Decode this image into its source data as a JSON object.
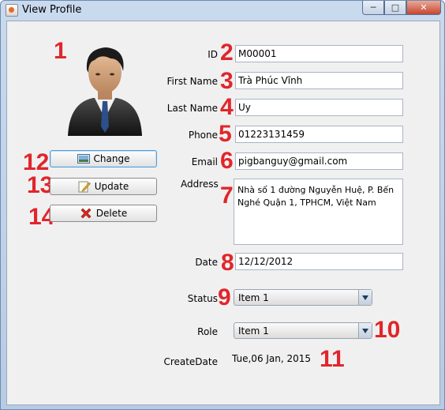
{
  "window": {
    "title": "View Profile",
    "controls": [
      "minimize",
      "restore",
      "close"
    ]
  },
  "markers": [
    "1",
    "2",
    "3",
    "4",
    "5",
    "6",
    "7",
    "8",
    "9",
    "10",
    "11",
    "12",
    "13",
    "14"
  ],
  "buttons": {
    "change": "Change",
    "update": "Update",
    "delete": "Delete"
  },
  "labels": {
    "id": "ID",
    "first_name": "First Name",
    "last_name": "Last Name",
    "phone": "Phone",
    "email": "Email",
    "address": "Address",
    "date": "Date",
    "status": "Status",
    "role": "Role",
    "create_date": "CreateDate"
  },
  "values": {
    "id": "M00001",
    "first_name": "Trà Phúc Vĩnh",
    "last_name": "Uy",
    "phone": "01223131459",
    "email": "pigbanguy@gmail.com",
    "address_line1": "Nhà số 1 đường Nguyễn Huệ, P. Bến",
    "address_line2": "Nghé Quận 1, TPHCM, Việt Nam",
    "date": "12/12/2012",
    "status": "Item 1",
    "role": "Item 1",
    "create_date": "Tue,06 Jan, 2015"
  }
}
